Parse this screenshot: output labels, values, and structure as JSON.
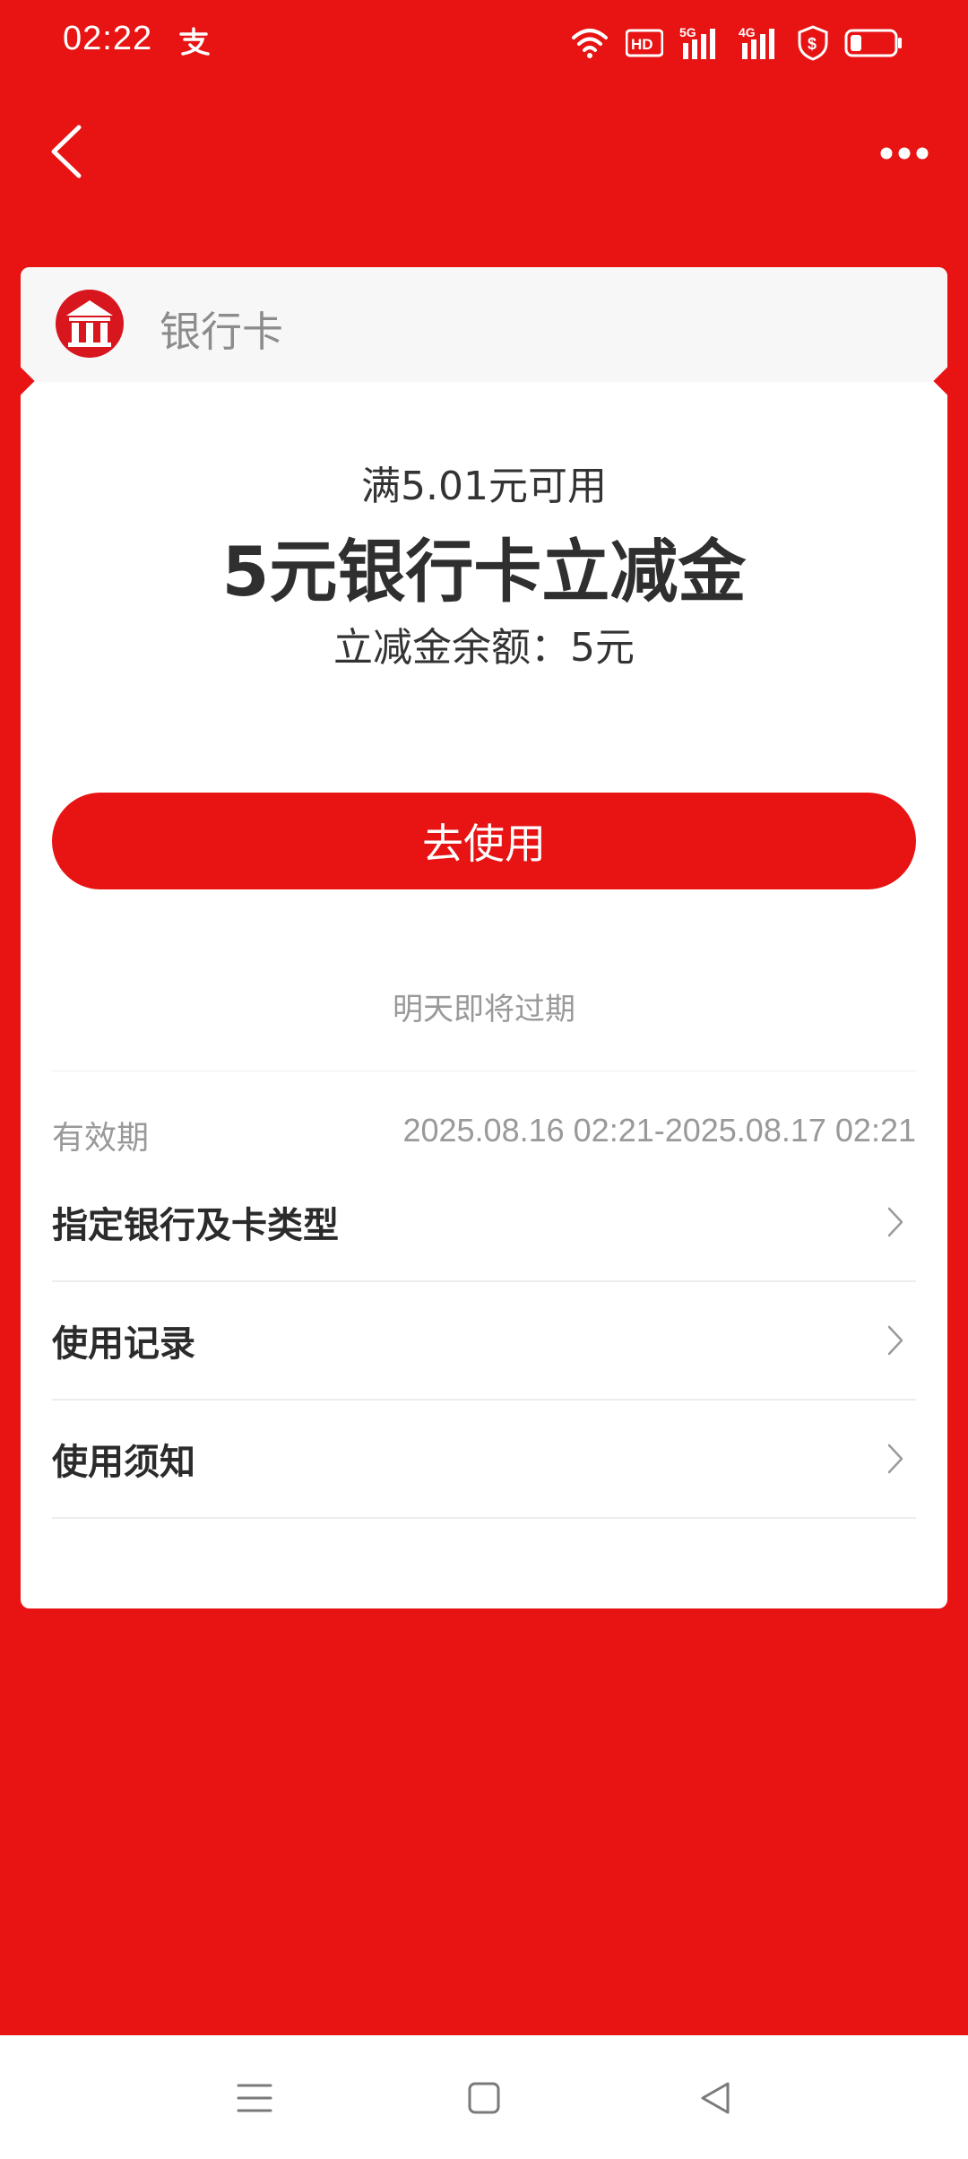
{
  "status_bar": {
    "time": "02:22",
    "icons": [
      "alipay-icon",
      "wifi-icon",
      "hd-icon",
      "5g-signal-icon",
      "4g-signal-icon",
      "shield-icon",
      "battery-icon"
    ],
    "hd_label": "HD",
    "net_5g": "5G",
    "net_4g": "4G"
  },
  "header": {
    "back_icon": "chevron-left-icon",
    "more_icon": "more-dots-icon"
  },
  "card": {
    "bank_name": "银行卡",
    "threshold": "满5.01元可用",
    "title": "5元银行卡立减金",
    "balance": "立减金余额：5元",
    "use_button": "去使用",
    "expire_note": "明天即将过期",
    "validity_label": "有效期",
    "validity_value": "2025.08.16 02:21-2025.08.17 02:21",
    "rows": [
      {
        "label": "指定银行及卡类型"
      },
      {
        "label": "使用记录"
      },
      {
        "label": "使用须知"
      }
    ]
  },
  "colors": {
    "brand_red": "#E81313",
    "card_head_bg": "#F7F7F7",
    "muted_text": "#999999"
  }
}
